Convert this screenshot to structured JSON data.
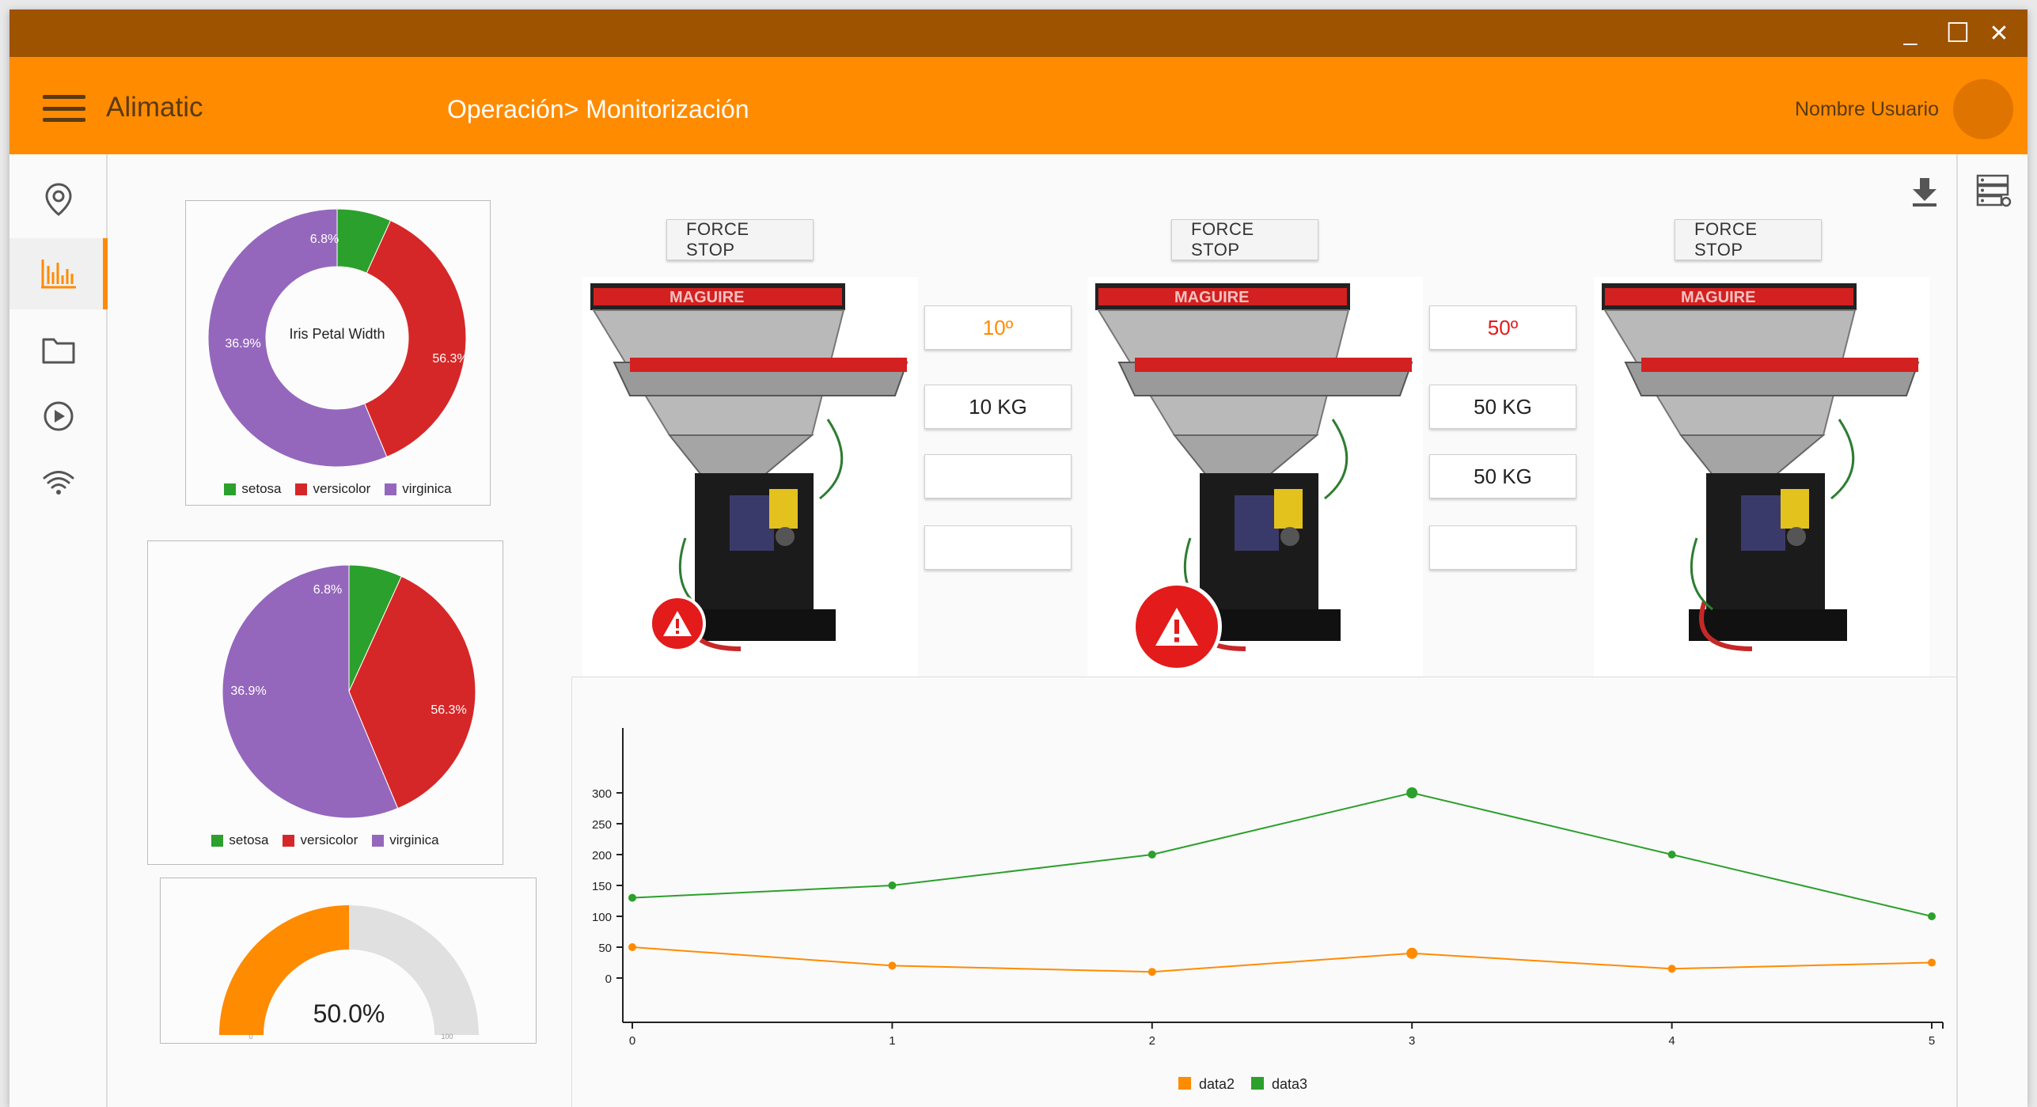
{
  "window": {
    "controls": {
      "minimize": "_",
      "maximize": "☐",
      "close": "✕"
    }
  },
  "appbar": {
    "app_title": "Alimatic",
    "breadcrumb": "Operación> Monitorización",
    "user_name": "Nombre Usuario"
  },
  "sidebar": {
    "items": [
      {
        "icon": "location-pin-icon"
      },
      {
        "icon": "bar-chart-icon",
        "active": true
      },
      {
        "icon": "folder-icon"
      },
      {
        "icon": "play-circle-icon"
      },
      {
        "icon": "wifi-icon"
      }
    ]
  },
  "colors": {
    "primary": "#ff8b00",
    "titlebar": "#9e5300",
    "setosa": "#2ca02c",
    "versicolor": "#d62728",
    "virginica": "#9467bd",
    "data2": "#ff8b00",
    "data3": "#2ca02c",
    "alert": "#e31b1b"
  },
  "machines": [
    {
      "button": "FORCE STOP",
      "brand": "MAGUIRE",
      "temperature": "10º",
      "temp_color": "orange",
      "field2": "10 KG",
      "field3": "",
      "field4": "",
      "alert": "small"
    },
    {
      "button": "FORCE STOP",
      "brand": "MAGUIRE",
      "temperature": "50º",
      "temp_color": "red",
      "field2": "50 KG",
      "field3": "50 KG",
      "field4": "",
      "alert": "large"
    },
    {
      "button": "FORCE STOP",
      "brand": "MAGUIRE"
    }
  ],
  "donut_chart": {
    "title": "Iris Petal Width",
    "labels": [
      "6.8%",
      "36.9%",
      "56.3%"
    ]
  },
  "pie_chart": {
    "labels": [
      "6.8%",
      "36.9%",
      "56.3%"
    ]
  },
  "legend_labels": [
    "setosa",
    "versicolor",
    "virginica"
  ],
  "gauge": {
    "value_label": "50.0%",
    "min_label": "0",
    "max_label": "100"
  },
  "chart_data": [
    {
      "type": "pie",
      "title": "Iris Petal Width",
      "donut": true,
      "categories": [
        "setosa",
        "versicolor",
        "virginica"
      ],
      "values": [
        6.8,
        36.9,
        56.3
      ]
    },
    {
      "type": "pie",
      "categories": [
        "setosa",
        "versicolor",
        "virginica"
      ],
      "values": [
        6.8,
        36.9,
        56.3
      ]
    },
    {
      "type": "gauge",
      "value": 50.0,
      "min": 0,
      "max": 100
    },
    {
      "type": "line",
      "x": [
        0,
        1,
        2,
        3,
        4,
        5
      ],
      "x_ticks": [
        "0",
        "1",
        "2",
        "3",
        "4",
        "5"
      ],
      "y_ticks": [
        "0",
        "50",
        "100",
        "150",
        "200",
        "250",
        "300"
      ],
      "ylim": [
        0,
        300
      ],
      "series": [
        {
          "name": "data2",
          "values": [
            50,
            20,
            10,
            40,
            15,
            25
          ]
        },
        {
          "name": "data3",
          "values": [
            130,
            150,
            200,
            300,
            200,
            100
          ]
        }
      ],
      "legend": "bottom"
    }
  ]
}
